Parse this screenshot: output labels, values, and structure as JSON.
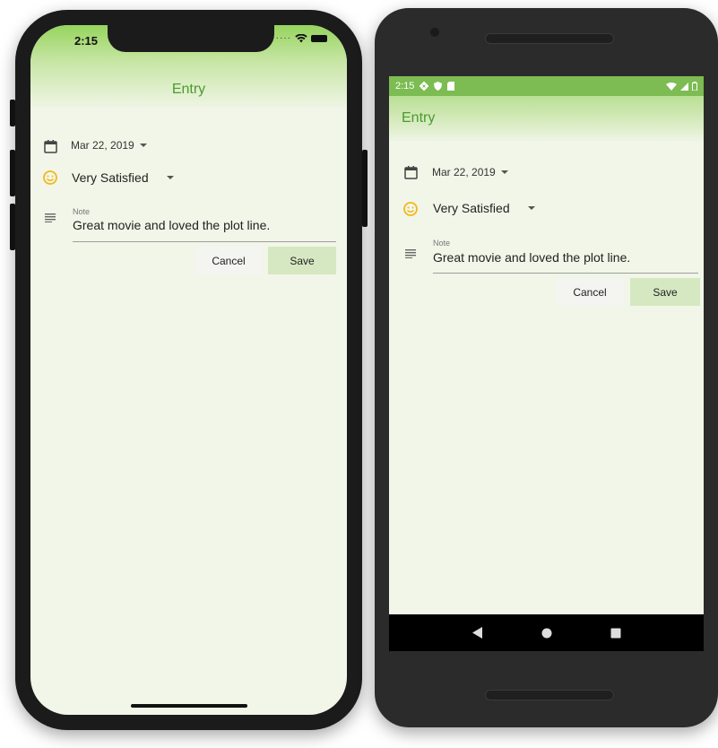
{
  "ios": {
    "time": "2:15",
    "title": "Entry",
    "date_value": "Mar 22, 2019",
    "mood_value": "Very Satisfied",
    "note_label": "Note",
    "note_value": "Great movie and loved the plot line.",
    "cancel_label": "Cancel",
    "save_label": "Save"
  },
  "android": {
    "time": "2:15",
    "title": "Entry",
    "date_value": "Mar 22, 2019",
    "mood_value": "Very Satisfied",
    "note_label": "Note",
    "note_value": "Great movie and loved the plot line.",
    "cancel_label": "Cancel",
    "save_label": "Save"
  },
  "icons": {
    "date": "calendar-icon",
    "mood": "satisfied-face-icon",
    "note": "notes-icon",
    "dropdown": "arrow-drop-down-icon",
    "settings": "gear-icon",
    "shield": "shield-icon",
    "sim": "sim-card-icon",
    "wifi": "wifi-icon",
    "signal": "cell-signal-icon",
    "battery": "battery-icon",
    "back": "back-triangle-icon",
    "home": "home-circle-icon",
    "recents": "recents-square-icon"
  },
  "colors": {
    "accent_green": "#4a9b2e",
    "header_green": "#96d45e",
    "background": "#f1f6e8",
    "save_button": "#d6e8c2",
    "mood_icon": "#f3b71a"
  }
}
